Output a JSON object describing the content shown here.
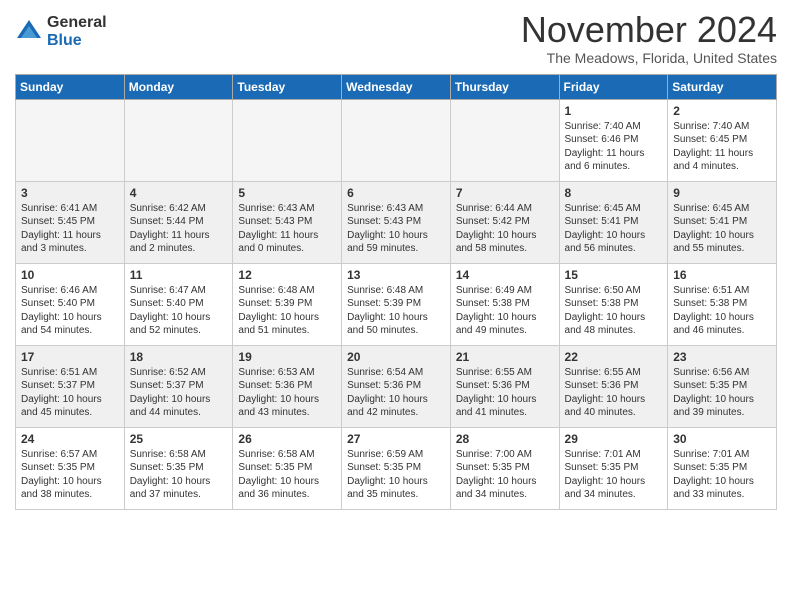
{
  "header": {
    "logo": {
      "general": "General",
      "blue": "Blue"
    },
    "title": "November 2024",
    "subtitle": "The Meadows, Florida, United States"
  },
  "weekdays": [
    "Sunday",
    "Monday",
    "Tuesday",
    "Wednesday",
    "Thursday",
    "Friday",
    "Saturday"
  ],
  "weeks": [
    [
      {
        "day": "",
        "info": ""
      },
      {
        "day": "",
        "info": ""
      },
      {
        "day": "",
        "info": ""
      },
      {
        "day": "",
        "info": ""
      },
      {
        "day": "",
        "info": ""
      },
      {
        "day": "1",
        "info": "Sunrise: 7:40 AM\nSunset: 6:46 PM\nDaylight: 11 hours and 6 minutes."
      },
      {
        "day": "2",
        "info": "Sunrise: 7:40 AM\nSunset: 6:45 PM\nDaylight: 11 hours and 4 minutes."
      }
    ],
    [
      {
        "day": "3",
        "info": "Sunrise: 6:41 AM\nSunset: 5:45 PM\nDaylight: 11 hours and 3 minutes."
      },
      {
        "day": "4",
        "info": "Sunrise: 6:42 AM\nSunset: 5:44 PM\nDaylight: 11 hours and 2 minutes."
      },
      {
        "day": "5",
        "info": "Sunrise: 6:43 AM\nSunset: 5:43 PM\nDaylight: 11 hours and 0 minutes."
      },
      {
        "day": "6",
        "info": "Sunrise: 6:43 AM\nSunset: 5:43 PM\nDaylight: 10 hours and 59 minutes."
      },
      {
        "day": "7",
        "info": "Sunrise: 6:44 AM\nSunset: 5:42 PM\nDaylight: 10 hours and 58 minutes."
      },
      {
        "day": "8",
        "info": "Sunrise: 6:45 AM\nSunset: 5:41 PM\nDaylight: 10 hours and 56 minutes."
      },
      {
        "day": "9",
        "info": "Sunrise: 6:45 AM\nSunset: 5:41 PM\nDaylight: 10 hours and 55 minutes."
      }
    ],
    [
      {
        "day": "10",
        "info": "Sunrise: 6:46 AM\nSunset: 5:40 PM\nDaylight: 10 hours and 54 minutes."
      },
      {
        "day": "11",
        "info": "Sunrise: 6:47 AM\nSunset: 5:40 PM\nDaylight: 10 hours and 52 minutes."
      },
      {
        "day": "12",
        "info": "Sunrise: 6:48 AM\nSunset: 5:39 PM\nDaylight: 10 hours and 51 minutes."
      },
      {
        "day": "13",
        "info": "Sunrise: 6:48 AM\nSunset: 5:39 PM\nDaylight: 10 hours and 50 minutes."
      },
      {
        "day": "14",
        "info": "Sunrise: 6:49 AM\nSunset: 5:38 PM\nDaylight: 10 hours and 49 minutes."
      },
      {
        "day": "15",
        "info": "Sunrise: 6:50 AM\nSunset: 5:38 PM\nDaylight: 10 hours and 48 minutes."
      },
      {
        "day": "16",
        "info": "Sunrise: 6:51 AM\nSunset: 5:38 PM\nDaylight: 10 hours and 46 minutes."
      }
    ],
    [
      {
        "day": "17",
        "info": "Sunrise: 6:51 AM\nSunset: 5:37 PM\nDaylight: 10 hours and 45 minutes."
      },
      {
        "day": "18",
        "info": "Sunrise: 6:52 AM\nSunset: 5:37 PM\nDaylight: 10 hours and 44 minutes."
      },
      {
        "day": "19",
        "info": "Sunrise: 6:53 AM\nSunset: 5:36 PM\nDaylight: 10 hours and 43 minutes."
      },
      {
        "day": "20",
        "info": "Sunrise: 6:54 AM\nSunset: 5:36 PM\nDaylight: 10 hours and 42 minutes."
      },
      {
        "day": "21",
        "info": "Sunrise: 6:55 AM\nSunset: 5:36 PM\nDaylight: 10 hours and 41 minutes."
      },
      {
        "day": "22",
        "info": "Sunrise: 6:55 AM\nSunset: 5:36 PM\nDaylight: 10 hours and 40 minutes."
      },
      {
        "day": "23",
        "info": "Sunrise: 6:56 AM\nSunset: 5:35 PM\nDaylight: 10 hours and 39 minutes."
      }
    ],
    [
      {
        "day": "24",
        "info": "Sunrise: 6:57 AM\nSunset: 5:35 PM\nDaylight: 10 hours and 38 minutes."
      },
      {
        "day": "25",
        "info": "Sunrise: 6:58 AM\nSunset: 5:35 PM\nDaylight: 10 hours and 37 minutes."
      },
      {
        "day": "26",
        "info": "Sunrise: 6:58 AM\nSunset: 5:35 PM\nDaylight: 10 hours and 36 minutes."
      },
      {
        "day": "27",
        "info": "Sunrise: 6:59 AM\nSunset: 5:35 PM\nDaylight: 10 hours and 35 minutes."
      },
      {
        "day": "28",
        "info": "Sunrise: 7:00 AM\nSunset: 5:35 PM\nDaylight: 10 hours and 34 minutes."
      },
      {
        "day": "29",
        "info": "Sunrise: 7:01 AM\nSunset: 5:35 PM\nDaylight: 10 hours and 34 minutes."
      },
      {
        "day": "30",
        "info": "Sunrise: 7:01 AM\nSunset: 5:35 PM\nDaylight: 10 hours and 33 minutes."
      }
    ]
  ]
}
